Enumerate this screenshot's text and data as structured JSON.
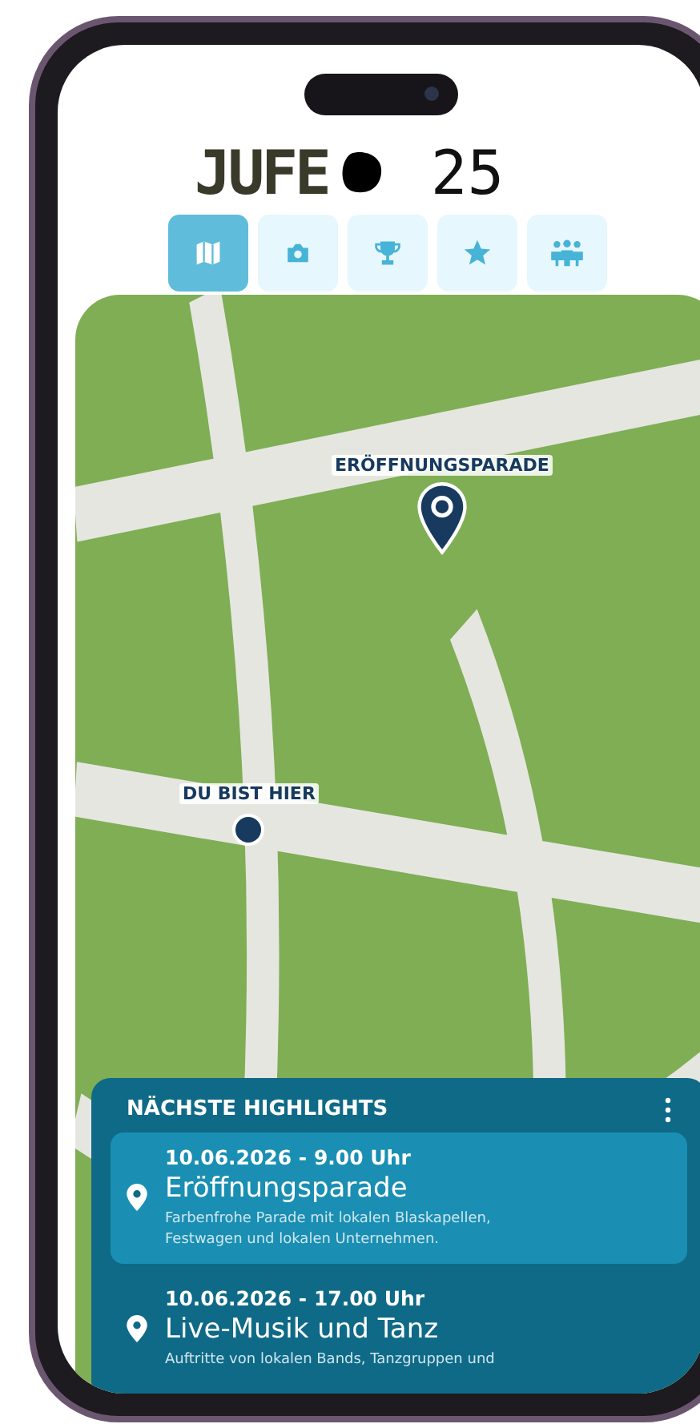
{
  "logo": {
    "text": "JUFE",
    "year": "25"
  },
  "tabs": [
    {
      "kind": "map",
      "selected": true
    },
    {
      "kind": "camera",
      "selected": false
    },
    {
      "kind": "trophy",
      "selected": false
    },
    {
      "kind": "star",
      "selected": false
    },
    {
      "kind": "people",
      "selected": false
    }
  ],
  "map": {
    "pins": [
      {
        "kind": "event",
        "label": "ERÖFFNUNGSPARADE"
      },
      {
        "kind": "you",
        "label": "DU BIST HIER"
      }
    ]
  },
  "highlights": {
    "title": "NÄCHSTE HIGHLIGHTS",
    "events": [
      {
        "date": "10.06.2026 - 9.00 Uhr",
        "title": "Eröffnungsparade",
        "description": "Farbenfrohe Parade mit lokalen Blaskapellen, Festwagen und lokalen Unternehmen.",
        "selected": true
      },
      {
        "date": "10.06.2026 - 17.00 Uhr",
        "title": "Live-Musik und Tanz",
        "description": "Auftritte von lokalen Bands, Tanzgruppen und",
        "selected": false
      }
    ]
  }
}
